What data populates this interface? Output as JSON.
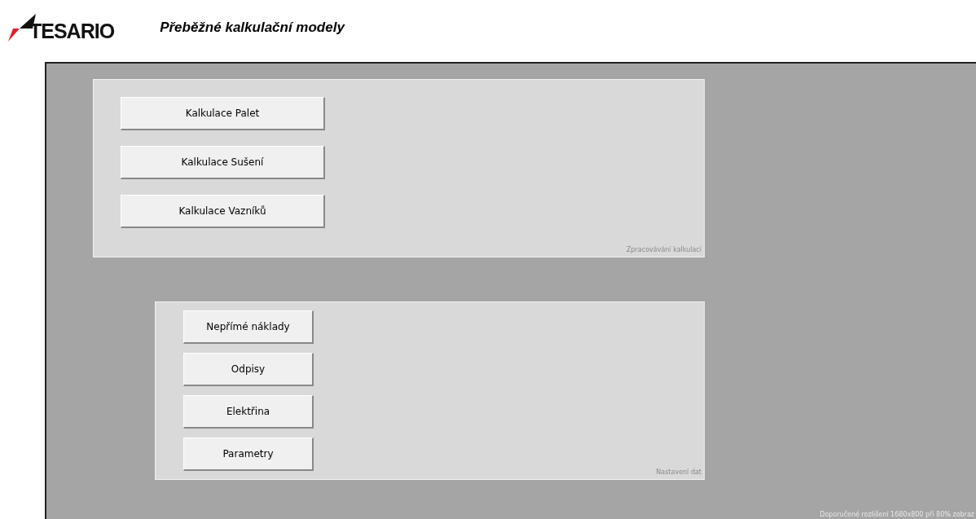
{
  "header": {
    "logo": "TESARIO",
    "title": "Přeběžné kalkulační modely"
  },
  "panels": [
    {
      "buttons": [
        "Kalkulace Palet",
        "Kalkulace Sušení",
        "Kalkulace Vazníků"
      ],
      "caption": "Zpracovávání kalkulací"
    },
    {
      "buttons": [
        "Nepřímé náklady",
        "Odpisy",
        "Elektřina",
        "Parametry"
      ],
      "caption": "Nastavení dat"
    }
  ],
  "footer_note": "Doporučené rozlišení 1680x800 při 80% zobraz"
}
